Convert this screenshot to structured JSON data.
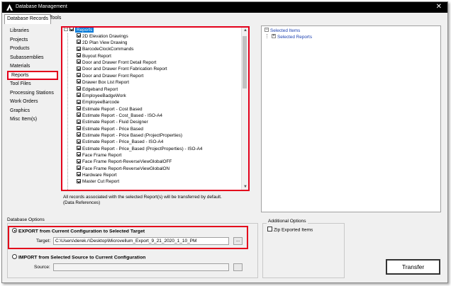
{
  "window": {
    "title": "Database Management",
    "close_glyph": "✕"
  },
  "tabs": [
    {
      "label": "Database Records"
    },
    {
      "label": "Tools"
    }
  ],
  "sidebar": {
    "items": [
      {
        "label": "Libraries"
      },
      {
        "label": "Projects"
      },
      {
        "label": "Products"
      },
      {
        "label": "Subassemblies"
      },
      {
        "label": "Materials"
      },
      {
        "label": "Reports"
      },
      {
        "label": "Tool Files"
      },
      {
        "label": "Processing Stations"
      },
      {
        "label": "Work Orders"
      },
      {
        "label": "Graphics"
      },
      {
        "label": "Misc Item(s)"
      }
    ],
    "selected": "Reports"
  },
  "tree": {
    "root": "Reports",
    "items": [
      "2D Elevation Drawings",
      "2D Plan View Drawing",
      "BarcodeClockCommands",
      "Buyout Report",
      "Door and Drawer Front Detail Report",
      "Door and Drawer Front Fabrication Report",
      "Door and Drawer Front Report",
      "Drawer Box List Report",
      "Edgeband Report",
      "EmployeeBadgeWork",
      "EmployeeBarcode",
      "Estimate Report - Cost Based",
      "Estimate Report - Cost_Based - ISO-A4",
      "Estimate Report - Fluid Designer",
      "Estimate Report - Price Based",
      "Estimate Report - Price Based (ProjectProperties)",
      "Estimate Report - Price_Based - ISO-A4",
      "Estimate Report - Price_Based (ProjectProperties) - ISO-A4",
      "Face Frame Report",
      "Face Frame Report-ReverseViewGlobalOFF",
      "Face Frame Report-ReverseViewGlobalON",
      "Hardware Report",
      "Master Cut Report"
    ]
  },
  "note": {
    "line1": "All records associated with the selected Report(s) will be transferred by default.",
    "line2": "(Data References)"
  },
  "selected_panel": {
    "root": "Selected Items",
    "child": "Selected Reports"
  },
  "database_options": {
    "label": "Database Options",
    "export_label": "EXPORT from Current Configuration to Selected Target",
    "target_label": "Target:",
    "target_value": "C:\\Users\\derek.r\\Desktop\\Microvellum_Export_9_21_2020_1_10_PM",
    "import_label": "IMPORT from Selected Source to Current Configuration",
    "source_label": "Source:",
    "source_value": "",
    "browse_label": "..."
  },
  "additional_options": {
    "label": "Additional Options",
    "zip_label": "Zip Exported Items"
  },
  "transfer_label": "Transfer",
  "colors": {
    "highlight_border": "#e3001b",
    "selection_blue": "#0078d7",
    "titlebar": "#000000"
  }
}
